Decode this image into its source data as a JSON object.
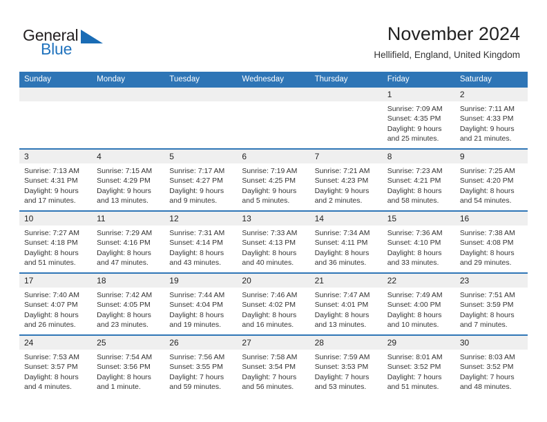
{
  "brand": {
    "logo_text_top": "General",
    "logo_text_bottom": "Blue",
    "accent_color": "#2e75b6",
    "logo_blue": "#1f72bd"
  },
  "header": {
    "title": "November 2024",
    "subtitle": "Hellifield, England, United Kingdom"
  },
  "calendar": {
    "weekday_headers": [
      "Sunday",
      "Monday",
      "Tuesday",
      "Wednesday",
      "Thursday",
      "Friday",
      "Saturday"
    ],
    "weeks": [
      [
        {
          "day": "",
          "empty": true
        },
        {
          "day": "",
          "empty": true
        },
        {
          "day": "",
          "empty": true
        },
        {
          "day": "",
          "empty": true
        },
        {
          "day": "",
          "empty": true
        },
        {
          "day": "1",
          "sunrise": "Sunrise: 7:09 AM",
          "sunset": "Sunset: 4:35 PM",
          "daylight": "Daylight: 9 hours and 25 minutes."
        },
        {
          "day": "2",
          "sunrise": "Sunrise: 7:11 AM",
          "sunset": "Sunset: 4:33 PM",
          "daylight": "Daylight: 9 hours and 21 minutes."
        }
      ],
      [
        {
          "day": "3",
          "sunrise": "Sunrise: 7:13 AM",
          "sunset": "Sunset: 4:31 PM",
          "daylight": "Daylight: 9 hours and 17 minutes."
        },
        {
          "day": "4",
          "sunrise": "Sunrise: 7:15 AM",
          "sunset": "Sunset: 4:29 PM",
          "daylight": "Daylight: 9 hours and 13 minutes."
        },
        {
          "day": "5",
          "sunrise": "Sunrise: 7:17 AM",
          "sunset": "Sunset: 4:27 PM",
          "daylight": "Daylight: 9 hours and 9 minutes."
        },
        {
          "day": "6",
          "sunrise": "Sunrise: 7:19 AM",
          "sunset": "Sunset: 4:25 PM",
          "daylight": "Daylight: 9 hours and 5 minutes."
        },
        {
          "day": "7",
          "sunrise": "Sunrise: 7:21 AM",
          "sunset": "Sunset: 4:23 PM",
          "daylight": "Daylight: 9 hours and 2 minutes."
        },
        {
          "day": "8",
          "sunrise": "Sunrise: 7:23 AM",
          "sunset": "Sunset: 4:21 PM",
          "daylight": "Daylight: 8 hours and 58 minutes."
        },
        {
          "day": "9",
          "sunrise": "Sunrise: 7:25 AM",
          "sunset": "Sunset: 4:20 PM",
          "daylight": "Daylight: 8 hours and 54 minutes."
        }
      ],
      [
        {
          "day": "10",
          "sunrise": "Sunrise: 7:27 AM",
          "sunset": "Sunset: 4:18 PM",
          "daylight": "Daylight: 8 hours and 51 minutes."
        },
        {
          "day": "11",
          "sunrise": "Sunrise: 7:29 AM",
          "sunset": "Sunset: 4:16 PM",
          "daylight": "Daylight: 8 hours and 47 minutes."
        },
        {
          "day": "12",
          "sunrise": "Sunrise: 7:31 AM",
          "sunset": "Sunset: 4:14 PM",
          "daylight": "Daylight: 8 hours and 43 minutes."
        },
        {
          "day": "13",
          "sunrise": "Sunrise: 7:33 AM",
          "sunset": "Sunset: 4:13 PM",
          "daylight": "Daylight: 8 hours and 40 minutes."
        },
        {
          "day": "14",
          "sunrise": "Sunrise: 7:34 AM",
          "sunset": "Sunset: 4:11 PM",
          "daylight": "Daylight: 8 hours and 36 minutes."
        },
        {
          "day": "15",
          "sunrise": "Sunrise: 7:36 AM",
          "sunset": "Sunset: 4:10 PM",
          "daylight": "Daylight: 8 hours and 33 minutes."
        },
        {
          "day": "16",
          "sunrise": "Sunrise: 7:38 AM",
          "sunset": "Sunset: 4:08 PM",
          "daylight": "Daylight: 8 hours and 29 minutes."
        }
      ],
      [
        {
          "day": "17",
          "sunrise": "Sunrise: 7:40 AM",
          "sunset": "Sunset: 4:07 PM",
          "daylight": "Daylight: 8 hours and 26 minutes."
        },
        {
          "day": "18",
          "sunrise": "Sunrise: 7:42 AM",
          "sunset": "Sunset: 4:05 PM",
          "daylight": "Daylight: 8 hours and 23 minutes."
        },
        {
          "day": "19",
          "sunrise": "Sunrise: 7:44 AM",
          "sunset": "Sunset: 4:04 PM",
          "daylight": "Daylight: 8 hours and 19 minutes."
        },
        {
          "day": "20",
          "sunrise": "Sunrise: 7:46 AM",
          "sunset": "Sunset: 4:02 PM",
          "daylight": "Daylight: 8 hours and 16 minutes."
        },
        {
          "day": "21",
          "sunrise": "Sunrise: 7:47 AM",
          "sunset": "Sunset: 4:01 PM",
          "daylight": "Daylight: 8 hours and 13 minutes."
        },
        {
          "day": "22",
          "sunrise": "Sunrise: 7:49 AM",
          "sunset": "Sunset: 4:00 PM",
          "daylight": "Daylight: 8 hours and 10 minutes."
        },
        {
          "day": "23",
          "sunrise": "Sunrise: 7:51 AM",
          "sunset": "Sunset: 3:59 PM",
          "daylight": "Daylight: 8 hours and 7 minutes."
        }
      ],
      [
        {
          "day": "24",
          "sunrise": "Sunrise: 7:53 AM",
          "sunset": "Sunset: 3:57 PM",
          "daylight": "Daylight: 8 hours and 4 minutes."
        },
        {
          "day": "25",
          "sunrise": "Sunrise: 7:54 AM",
          "sunset": "Sunset: 3:56 PM",
          "daylight": "Daylight: 8 hours and 1 minute."
        },
        {
          "day": "26",
          "sunrise": "Sunrise: 7:56 AM",
          "sunset": "Sunset: 3:55 PM",
          "daylight": "Daylight: 7 hours and 59 minutes."
        },
        {
          "day": "27",
          "sunrise": "Sunrise: 7:58 AM",
          "sunset": "Sunset: 3:54 PM",
          "daylight": "Daylight: 7 hours and 56 minutes."
        },
        {
          "day": "28",
          "sunrise": "Sunrise: 7:59 AM",
          "sunset": "Sunset: 3:53 PM",
          "daylight": "Daylight: 7 hours and 53 minutes."
        },
        {
          "day": "29",
          "sunrise": "Sunrise: 8:01 AM",
          "sunset": "Sunset: 3:52 PM",
          "daylight": "Daylight: 7 hours and 51 minutes."
        },
        {
          "day": "30",
          "sunrise": "Sunrise: 8:03 AM",
          "sunset": "Sunset: 3:52 PM",
          "daylight": "Daylight: 7 hours and 48 minutes."
        }
      ]
    ]
  }
}
